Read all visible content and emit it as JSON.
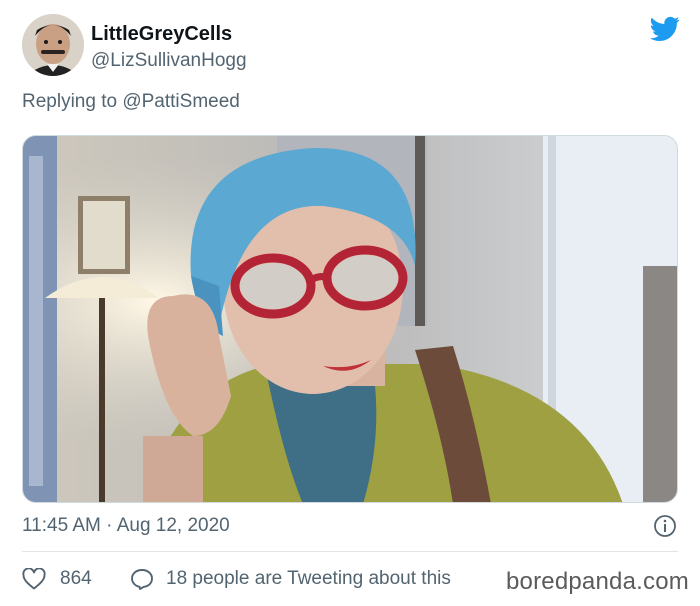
{
  "tweet": {
    "display_name": "LittleGreyCells",
    "handle": "@LizSullivanHogg",
    "replying_prefix": "Replying to",
    "replying_to": "@PattiSmeed",
    "timestamp": "11:45 AM · Aug 12, 2020",
    "likes": "864",
    "conversation": "18 people are Tweeting about this",
    "brand_color": "#1d9bf0"
  },
  "watermark": "boredpanda.com",
  "icons": {
    "platform": "twitter-bird-icon",
    "info": "info-icon",
    "like": "heart-icon",
    "conversation": "speech-bubble-icon"
  }
}
